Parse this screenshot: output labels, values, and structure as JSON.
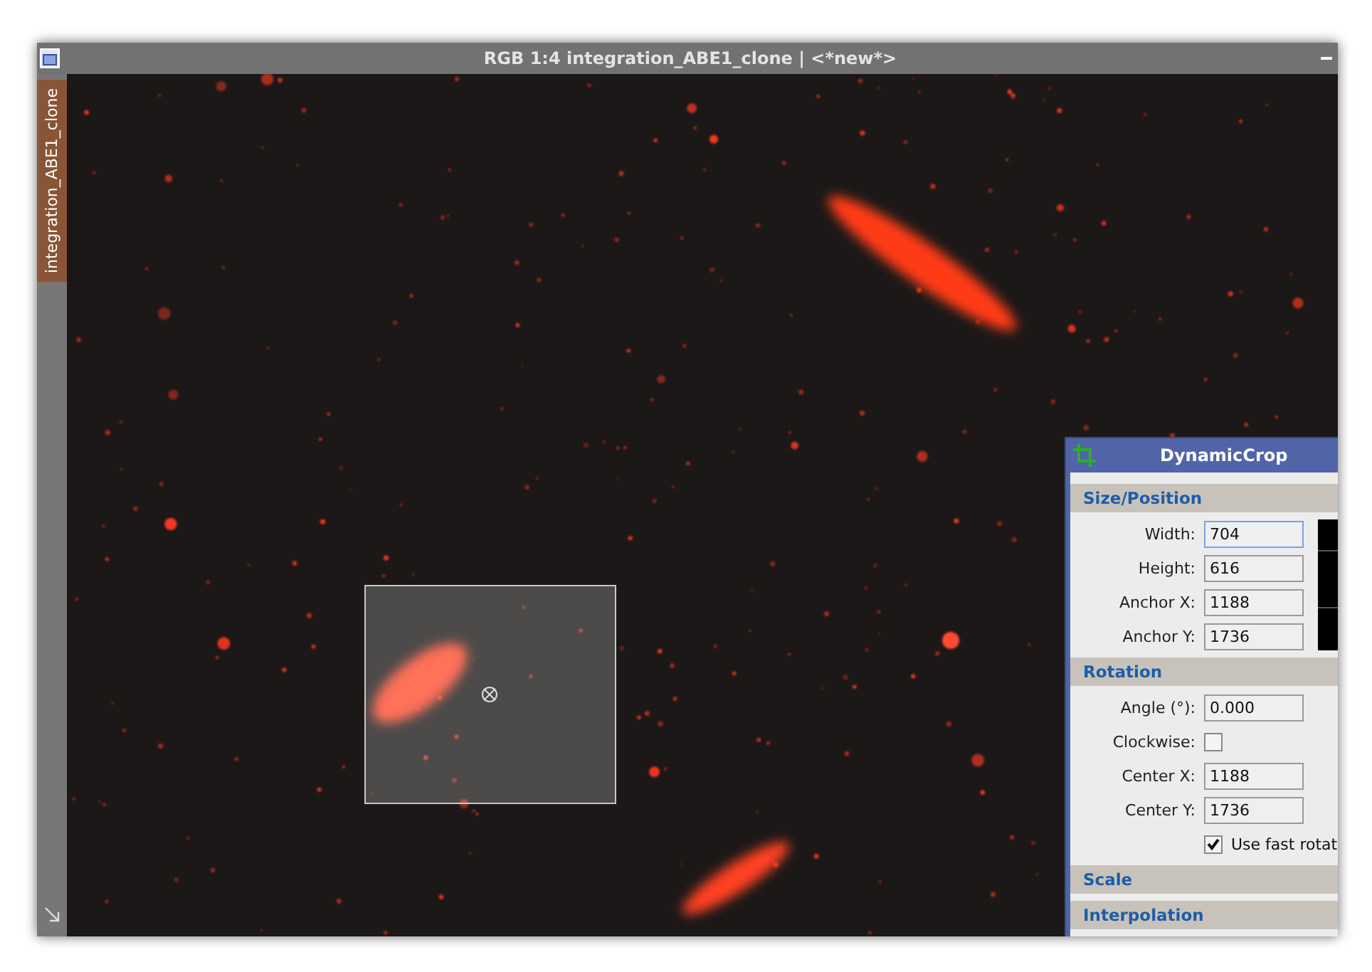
{
  "window": {
    "title": "RGB 1:4 integration_ABE1_clone | <*new*>"
  },
  "side_tab": {
    "label": "integration_ABE1_clone"
  },
  "tool_panel": {
    "title": "DynamicCrop",
    "sections": [
      {
        "title": "Size/Position",
        "fields": [
          {
            "kind": "input",
            "label": "Width:",
            "value": "704",
            "focused": true
          },
          {
            "kind": "input",
            "label": "Height:",
            "value": "616",
            "focused": false
          },
          {
            "kind": "input",
            "label": "Anchor X:",
            "value": "1188",
            "focused": false
          },
          {
            "kind": "input",
            "label": "Anchor Y:",
            "value": "1736",
            "focused": false
          }
        ]
      },
      {
        "title": "Rotation",
        "fields": [
          {
            "kind": "input",
            "label": "Angle (°):",
            "value": "0.000",
            "focused": false
          },
          {
            "kind": "checkbox",
            "label": "Clockwise:",
            "checked": false
          },
          {
            "kind": "input",
            "label": "Center X:",
            "value": "1188",
            "focused": false
          },
          {
            "kind": "input",
            "label": "Center Y:",
            "value": "1736",
            "focused": false
          },
          {
            "kind": "option",
            "label": "Use fast rotat",
            "checked": true
          }
        ]
      },
      {
        "title": "Scale"
      },
      {
        "title": "Interpolation"
      }
    ]
  }
}
